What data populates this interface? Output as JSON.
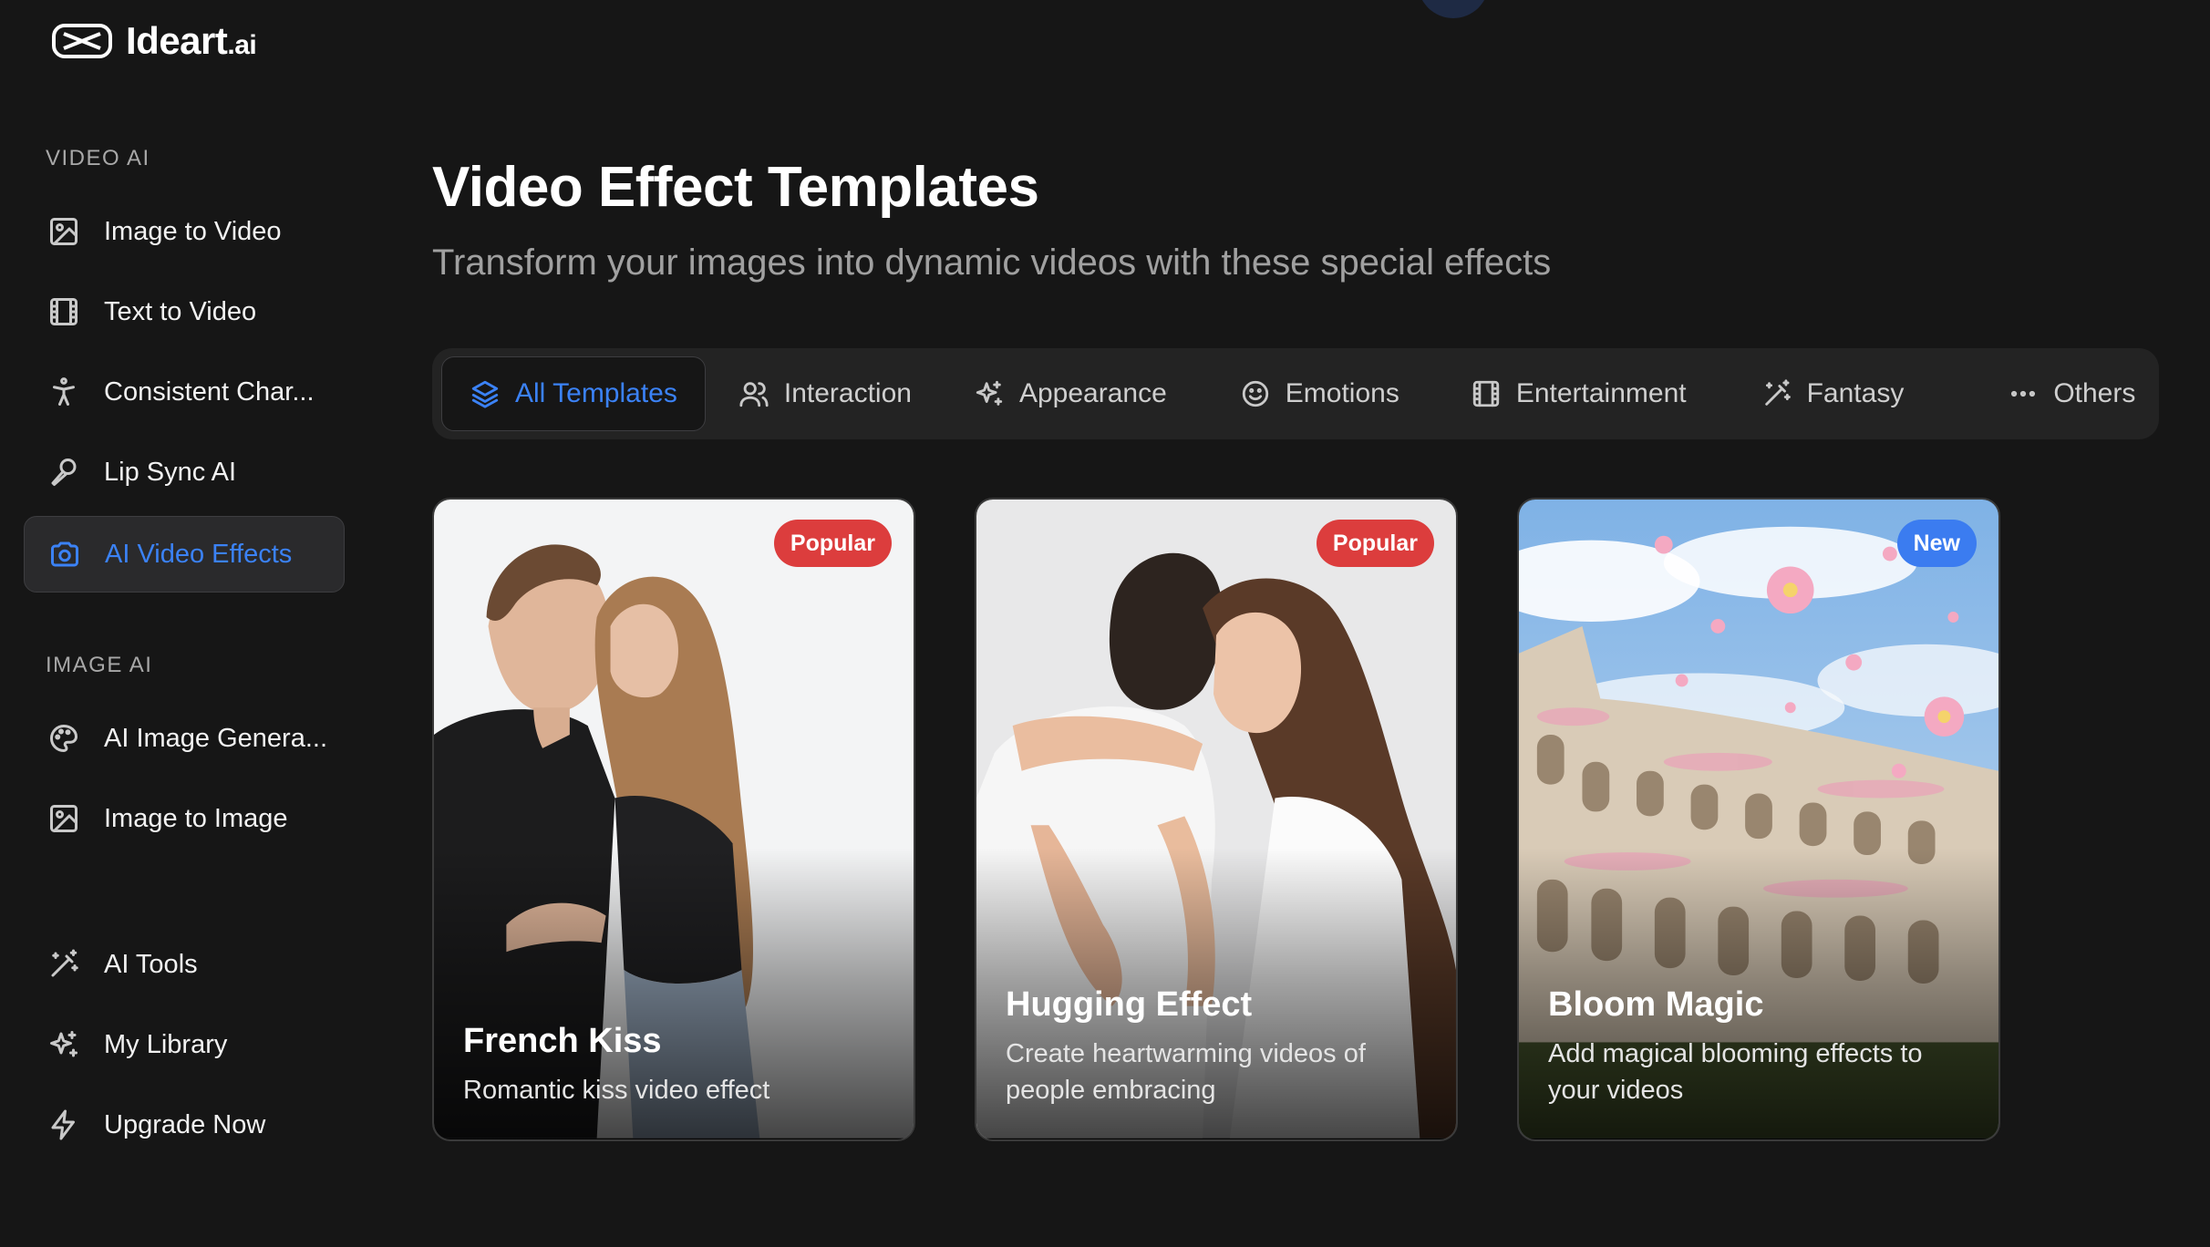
{
  "brand": {
    "name": "Ideart",
    "suffix": ".ai"
  },
  "sidebar": {
    "video_section": "VIDEO AI",
    "video_items": [
      {
        "label": "Image to Video",
        "icon": "image-icon"
      },
      {
        "label": "Text to Video",
        "icon": "film-icon"
      },
      {
        "label": "Consistent Char...",
        "icon": "person-icon"
      },
      {
        "label": "Lip Sync AI",
        "icon": "microphone-icon"
      },
      {
        "label": "AI Video Effects",
        "icon": "camera-icon",
        "active": true
      }
    ],
    "image_section": "IMAGE AI",
    "image_items": [
      {
        "label": "AI Image Genera...",
        "icon": "palette-icon"
      },
      {
        "label": "Image to Image",
        "icon": "image-icon"
      }
    ],
    "bottom_items": [
      {
        "label": "AI Tools",
        "icon": "magic-wand-icon"
      },
      {
        "label": "My Library",
        "icon": "sparkles-icon"
      },
      {
        "label": "Upgrade Now",
        "icon": "lightning-icon"
      }
    ]
  },
  "main": {
    "title": "Video Effect Templates",
    "subtitle": "Transform your images into dynamic videos with these special effects",
    "tabs": [
      {
        "label": "All Templates",
        "icon": "layers-icon",
        "active": true
      },
      {
        "label": "Interaction",
        "icon": "users-icon"
      },
      {
        "label": "Appearance",
        "icon": "sparkles-icon"
      },
      {
        "label": "Emotions",
        "icon": "smile-icon"
      },
      {
        "label": "Entertainment",
        "icon": "film-icon"
      },
      {
        "label": "Fantasy",
        "icon": "magic-wand-icon"
      },
      {
        "label": "Others",
        "icon": "more-icon"
      }
    ],
    "cards": [
      {
        "title": "French Kiss",
        "description": "Romantic kiss video effect",
        "badge": "Popular"
      },
      {
        "title": "Hugging Effect",
        "description": "Create heartwarming videos of people embracing",
        "badge": "Popular"
      },
      {
        "title": "Bloom Magic",
        "description": "Add magical blooming effects to your videos",
        "badge": "New"
      }
    ]
  },
  "colors": {
    "accent": "#3b82f6",
    "badge_popular": "#dc3d3d",
    "badge_new": "#3b7cf0",
    "background": "#161616"
  }
}
